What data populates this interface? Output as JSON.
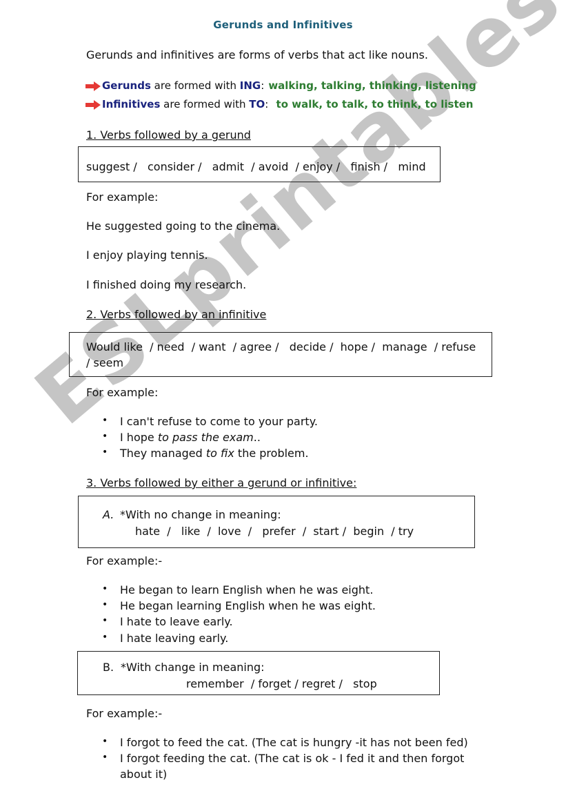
{
  "document": {
    "title": "Gerunds and Infinitives",
    "intro": "Gerunds and infinitives are forms of verbs that act like nouns.",
    "rules": [
      {
        "keyword": "Gerunds",
        "text": " are formed with ",
        "marker": "ING",
        "colon": ":",
        "examples": "walking, talking, thinking, listening"
      },
      {
        "keyword": "Infinitives",
        "text": " are formed with ",
        "marker": "TO",
        "colon": ":",
        "examples": " to walk, to talk, to think, to listen"
      }
    ],
    "section1": {
      "heading": "1. Verbs followed by a gerund",
      "verbs": "suggest /   consider /   admit  / avoid  / enjoy /   finish /   mind",
      "for_example": "For example:",
      "examples": [
        "He suggested going to the cinema.",
        "I enjoy playing tennis.",
        "I finished doing my research."
      ]
    },
    "section2": {
      "heading": "2. Verbs followed by an infinitive",
      "verbs_line1": "Would like  / need  / want  / agree /   decide /  hope /  manage  / refuse",
      "verbs_line2": "/ seem",
      "for_example": "For example:",
      "examples": [
        {
          "before": "I can't refuse to come to your party.",
          "italic": "",
          "after": ""
        },
        {
          "before": "I hope ",
          "italic": "to pass the exam",
          "after": ".."
        },
        {
          "before": "They managed ",
          "italic": "to fix",
          "after": " the problem."
        }
      ]
    },
    "section3": {
      "heading": "3. Verbs followed by either a gerund or infinitive:",
      "partA": {
        "label": "A.",
        "title": "*With no change in meaning:",
        "verbs": "hate  /   like  /  love  /   prefer  /  start /  begin  / try"
      },
      "for_example_a": "For example:-",
      "examples_a": [
        "He began to learn English when he was eight.",
        "He began learning English when he was eight.",
        "I hate to leave early.",
        "I hate leaving early."
      ],
      "partB": {
        "label": "B.",
        "title": "*With change in meaning:",
        "verbs": "remember  / forget / regret /   stop"
      },
      "for_example_b": "For example:-",
      "examples_b": [
        "I forgot to feed the cat. (The cat is hungry -it has not been fed)",
        "I forgot feeding the cat. (The cat is ok - I fed it and then forgot",
        "about it)"
      ]
    },
    "watermark": "ESLprintables.com",
    "colors": {
      "title": "#1e5f7a",
      "keyword": "#1a237e",
      "example": "#2e7d32",
      "arrow": "#e53935"
    }
  }
}
